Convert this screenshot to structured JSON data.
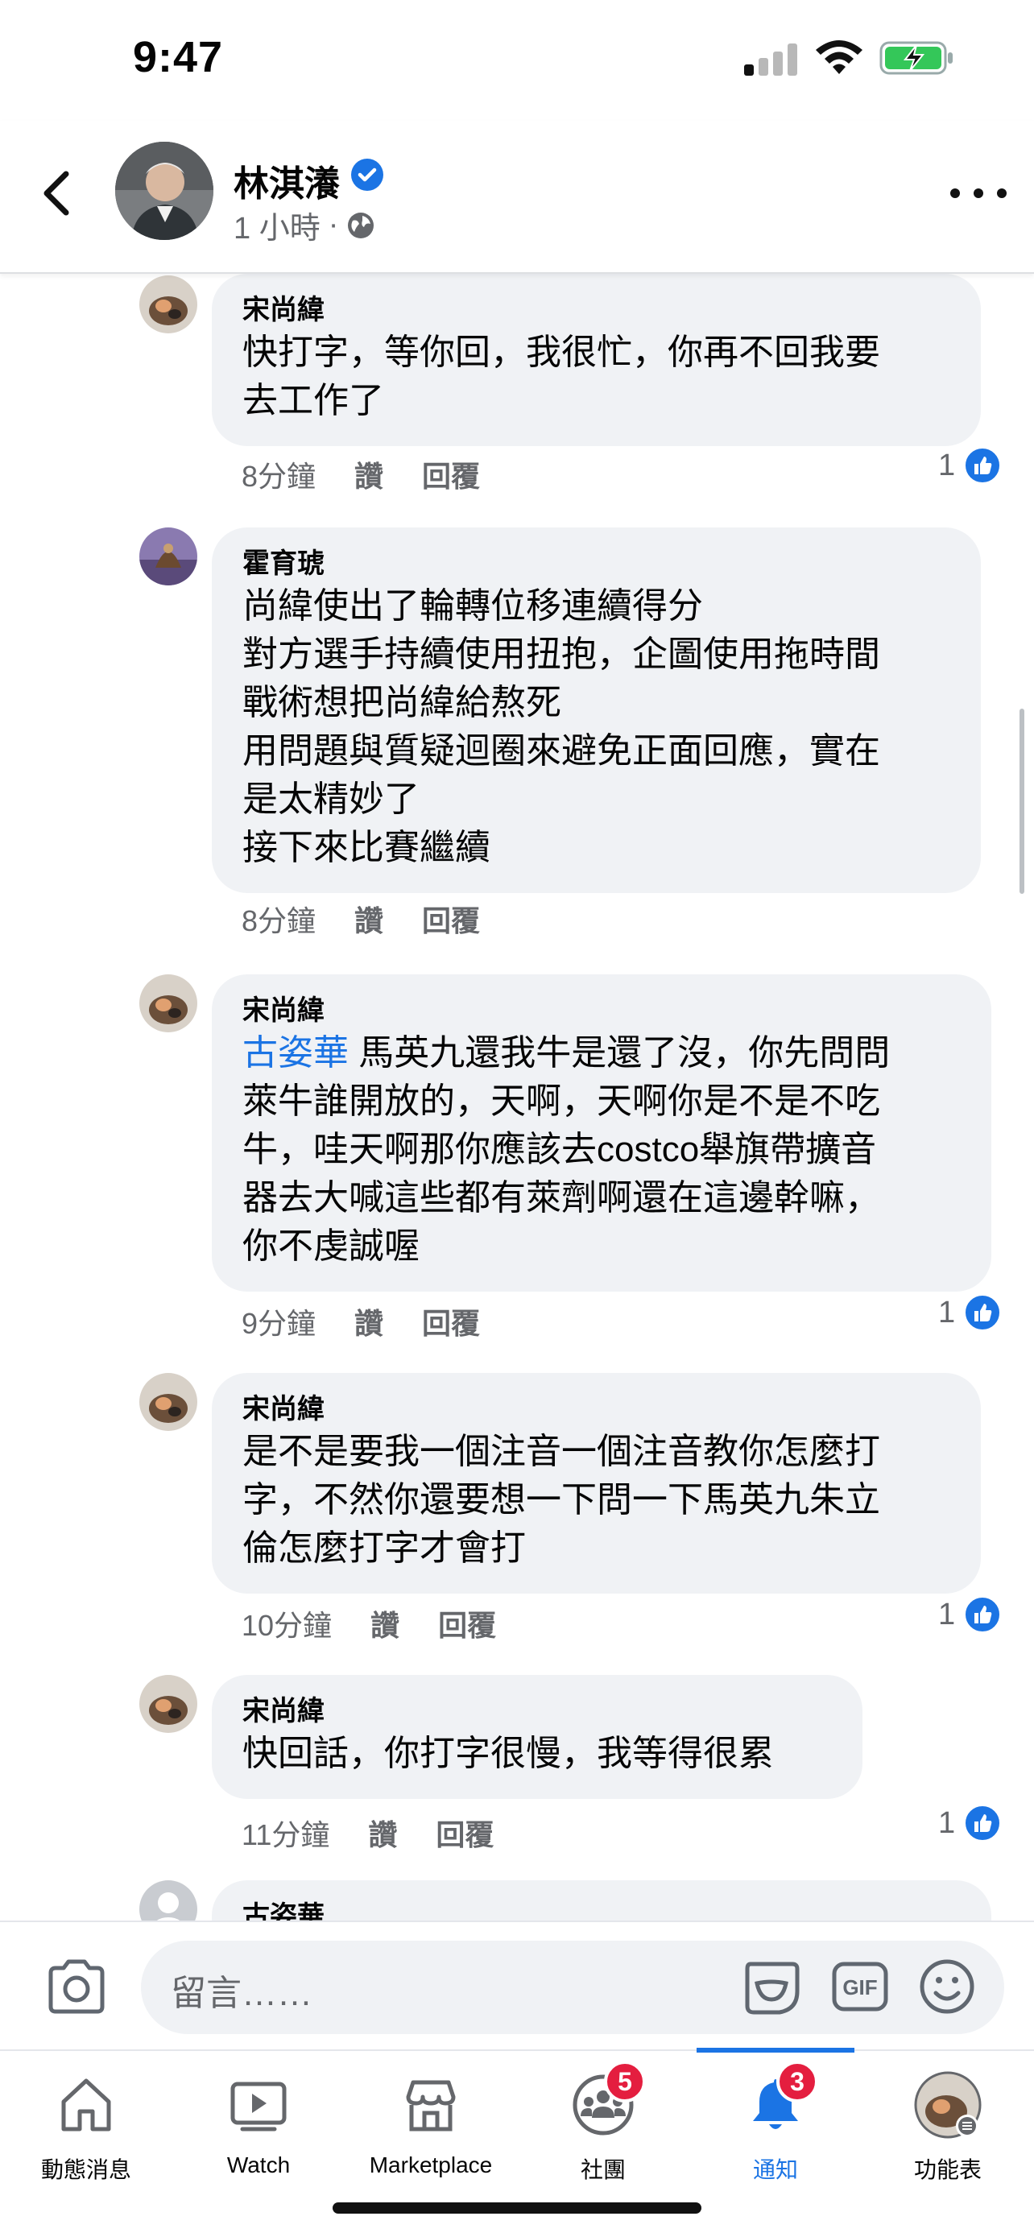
{
  "status_bar": {
    "time": "9:47"
  },
  "header": {
    "name": "林淇瀁",
    "time_ago": "1 小時",
    "separator": "·"
  },
  "comments": [
    {
      "name": "宋尚緯",
      "mention": "",
      "text": "快打字，等你回，我很忙，你再不回我要\n去工作了",
      "time": "8分鐘",
      "like_label": "讚",
      "reply_label": "回覆",
      "likes": "1"
    },
    {
      "name": "霍育琥",
      "mention": "",
      "text": "尚緯使出了輪轉位移連續得分\n對方選手持續使用扭抱，企圖使用拖時間\n戰術想把尚緯給熬死\n用問題與質疑迴圈來避免正面回應，實在\n是太精妙了\n接下來比賽繼續",
      "time": "8分鐘",
      "like_label": "讚",
      "reply_label": "回覆",
      "likes": ""
    },
    {
      "name": "宋尚緯",
      "mention": "古姿華",
      "text": " 馬英九還我牛是還了沒，你先問問\n萊牛誰開放的，天啊，天啊你是不是不吃\n牛，哇天啊那你應該去costco舉旗帶擴音\n器去大喊這些都有萊劑啊還在這邊幹嘛，\n你不虔誠喔",
      "time": "9分鐘",
      "like_label": "讚",
      "reply_label": "回覆",
      "likes": "1"
    },
    {
      "name": "宋尚緯",
      "mention": "",
      "text": "是不是要我一個注音一個注音教你怎麼打\n字，不然你還要想一下問一下馬英九朱立\n倫怎麼打字才會打",
      "time": "10分鐘",
      "like_label": "讚",
      "reply_label": "回覆",
      "likes": "1"
    },
    {
      "name": "宋尚緯",
      "mention": "",
      "text": "快回話，你打字很慢，我等得很累",
      "time": "11分鐘",
      "like_label": "讚",
      "reply_label": "回覆",
      "likes": "1"
    },
    {
      "name": "古姿華",
      "mention": "",
      "text": "",
      "time": "",
      "like_label": "",
      "reply_label": "",
      "likes": ""
    }
  ],
  "composer": {
    "placeholder": "留言……"
  },
  "nav": [
    {
      "label": "動態消息",
      "icon": "home-icon",
      "badge": ""
    },
    {
      "label": "Watch",
      "icon": "watch-icon",
      "badge": ""
    },
    {
      "label": "Marketplace",
      "icon": "marketplace-icon",
      "badge": ""
    },
    {
      "label": "社團",
      "icon": "groups-icon",
      "badge": "5"
    },
    {
      "label": "通知",
      "icon": "bell-icon",
      "badge": "3"
    },
    {
      "label": "功能表",
      "icon": "menu-avatar-icon",
      "badge": ""
    }
  ],
  "colors": {
    "accent": "#1b74e4",
    "badge": "#e41e3f",
    "bubble": "#f0f2f5",
    "meta": "#65676b"
  }
}
